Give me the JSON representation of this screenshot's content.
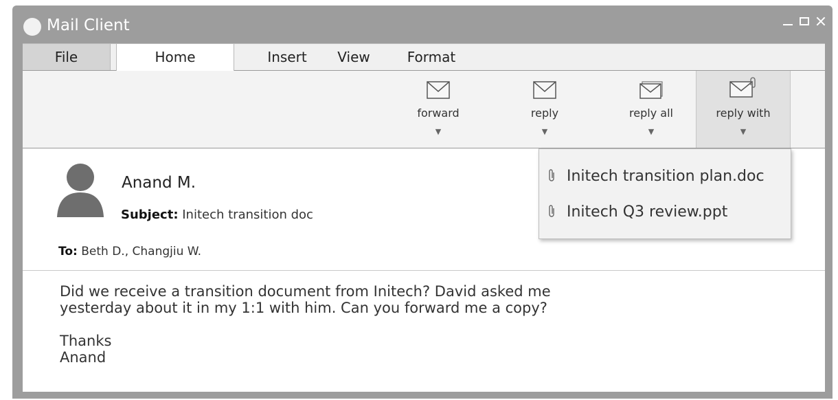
{
  "window": {
    "title": "Mail Client"
  },
  "menu": {
    "file": "File",
    "home": "Home",
    "insert": "Insert",
    "view": "View",
    "format": "Format"
  },
  "ribbon": {
    "forward": "forward",
    "reply": "reply",
    "reply_all": "reply all",
    "reply_with": "reply with",
    "dropdown_arrow": "▼"
  },
  "email": {
    "sender": "Anand M.",
    "subject_label": "Subject:",
    "subject": "Initech transition doc",
    "to_label": "To:",
    "to": "Beth D., Changjiu W.",
    "body_line1": "Did we receive a transition document from Initech? David asked me",
    "body_line2": "yesterday about it in my 1:1 with him. Can you forward me a copy?",
    "body_line3": "Thanks",
    "body_line4": "Anand"
  },
  "attachments": [
    {
      "name": "Initech transition plan.doc",
      "icon": "paperclip-icon"
    },
    {
      "name": "Initech Q3 review.ppt",
      "icon": "paperclip-icon"
    }
  ],
  "colors": {
    "window_chrome": "#9d9d9d",
    "ribbon_bg": "#f3f3f3",
    "dropdown_bg": "#f2f2f2"
  }
}
